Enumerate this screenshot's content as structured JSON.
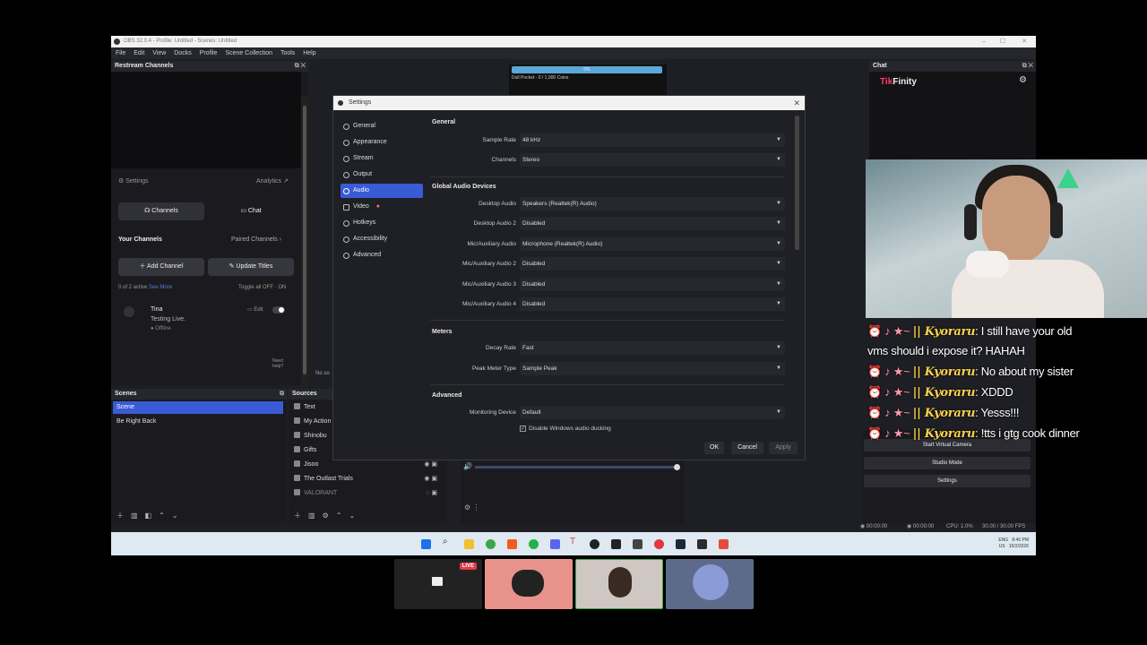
{
  "window": {
    "title": "OBS 32.0.4 - Profile: Untitled - Scenes: Untitled",
    "controls": [
      "–",
      "☐",
      "✕"
    ]
  },
  "menu": [
    "File",
    "Edit",
    "View",
    "Docks",
    "Profile",
    "Scene Collection",
    "Tools",
    "Help"
  ],
  "restream": {
    "title": "Restream Channels",
    "settings": "Settings",
    "analytics": "Analytics",
    "tab_channels": "Channels",
    "tab_chat": "Chat",
    "your_channels": "Your Channels",
    "paired_channels": "Paired Channels",
    "add_channel": "Add Channel",
    "update_titles": "Update Titles",
    "active_count": "0 of 2 active",
    "see_more": "See More",
    "toggle_all": "Toggle all OFF · ON",
    "channel_name": "Tina",
    "channel_title": "Testing Live.",
    "channel_status": "Offline",
    "edit": "Edit",
    "need_help": "Need help?",
    "no_source": "No so"
  },
  "preview": {
    "goal": "0%",
    "caption": "Dull Pocket - 0 / 1,000 Coins"
  },
  "scenes": {
    "title": "Scenes",
    "items": [
      "Scene",
      "Be Right Back"
    ]
  },
  "sources": {
    "title": "Sources",
    "items": [
      "Text",
      "My Action",
      "Shinobu",
      "Gifts",
      "Jisoo",
      "The Outlast Trials",
      "VALORANT"
    ]
  },
  "controls": {
    "start_virtual_camera": "Start Virtual Camera",
    "studio_mode": "Studio Mode",
    "settings": "Settings"
  },
  "chat_dock": {
    "title": "Chat",
    "brand_tik": "Tik",
    "brand_rest": "Finity"
  },
  "statusbar": {
    "rec_time": "00:00:00",
    "stream_time": "00:00:00",
    "cpu": "CPU: 1.0%",
    "fps": "30.00 / 30.00 FPS"
  },
  "tray": {
    "lang": "ENG",
    "region": "US",
    "time": "8:40 PM",
    "date": "15/2/2026"
  },
  "settings": {
    "title": "Settings",
    "nav": [
      "General",
      "Appearance",
      "Stream",
      "Output",
      "Audio",
      "Video",
      "Hotkeys",
      "Accessibility",
      "Advanced"
    ],
    "active_nav": "Audio",
    "general_header": "General",
    "sample_rate_label": "Sample Rate",
    "sample_rate_value": "48 kHz",
    "channels_label": "Channels",
    "channels_value": "Stereo",
    "global_header": "Global Audio Devices",
    "devices": [
      {
        "label": "Desktop Audio",
        "value": "Speakers (Realtek(R) Audio)"
      },
      {
        "label": "Desktop Audio 2",
        "value": "Disabled"
      },
      {
        "label": "Mic/Auxiliary Audio",
        "value": "Microphone (Realtek(R) Audio)"
      },
      {
        "label": "Mic/Auxiliary Audio 2",
        "value": "Disabled"
      },
      {
        "label": "Mic/Auxiliary Audio 3",
        "value": "Disabled"
      },
      {
        "label": "Mic/Auxiliary Audio 4",
        "value": "Disabled"
      }
    ],
    "meters_header": "Meters",
    "decay_label": "Decay Rate",
    "decay_value": "Fast",
    "peak_label": "Peak Meter Type",
    "peak_value": "Sample Peak",
    "advanced_header": "Advanced",
    "monitor_label": "Monitoring Device",
    "monitor_value": "Default",
    "ducking": "Disable Windows audio ducking",
    "ok": "OK",
    "cancel": "Cancel",
    "apply": "Apply"
  },
  "chat_overlay": [
    {
      "badges": "⏰ ♪ ★~",
      "user": "|| Kyoraru",
      "text": ": I still have your old"
    },
    {
      "badges": "",
      "user": "",
      "text": "vms should i expose it? HAHAH"
    },
    {
      "badges": "⏰ ♪ ★~",
      "user": "|| Kyoraru",
      "text": ": No about my sister"
    },
    {
      "badges": "⏰ ♪ ★~",
      "user": "|| Kyoraru",
      "text": ": XDDD"
    },
    {
      "badges": "⏰ ♪ ★~",
      "user": "|| Kyoraru",
      "text": ": Yesss!!!"
    },
    {
      "badges": "⏰ ♪ ★~",
      "user": "|| Kyoraru",
      "text": ": !tts i gtg cook dinner"
    }
  ],
  "thumbs": {
    "live": "LIVE"
  },
  "colors": {
    "accent": "#3a5bd6",
    "tiktok_red": "#ff3b6a",
    "username": "#ffd44a"
  }
}
